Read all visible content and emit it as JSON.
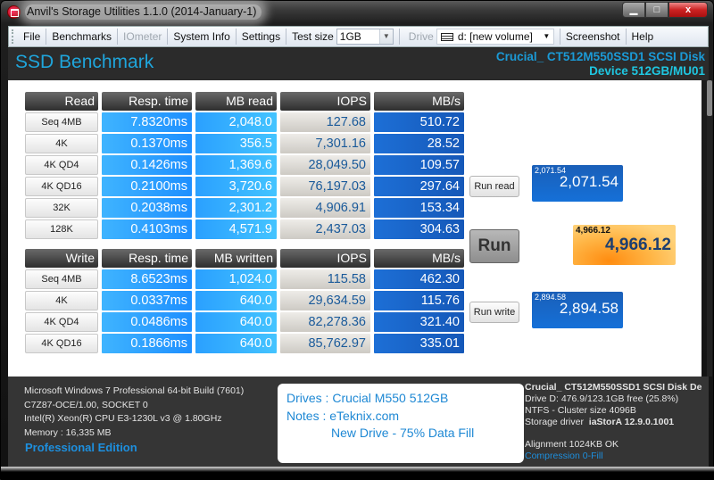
{
  "window": {
    "title": "Anvil's Storage Utilities 1.1.0 (2014-January-1)",
    "controls": {
      "minimize": "▁",
      "maximize": "□",
      "close": "x"
    }
  },
  "menu": {
    "file": "File",
    "benchmarks": "Benchmarks",
    "iometer": "IOmeter",
    "system_info": "System Info",
    "settings": "Settings",
    "test_size_label": "Test size",
    "test_size_value": "1GB",
    "drive_label": "Drive",
    "drive_value": "d: [new volume]",
    "screenshot": "Screenshot",
    "help": "Help"
  },
  "header": {
    "title": "SSD Benchmark",
    "device_line1": "Crucial_ CT512M550SSD1 SCSI Disk",
    "device_line2": "Device 512GB/MU01"
  },
  "read": {
    "headers": [
      "Read",
      "Resp. time",
      "MB read",
      "IOPS",
      "MB/s"
    ],
    "rows": [
      {
        "label": "Seq 4MB",
        "resp": "7.8320ms",
        "mb": "2,048.0",
        "iops": "127.68",
        "mbs": "510.72"
      },
      {
        "label": "4K",
        "resp": "0.1370ms",
        "mb": "356.5",
        "iops": "7,301.16",
        "mbs": "28.52"
      },
      {
        "label": "4K QD4",
        "resp": "0.1426ms",
        "mb": "1,369.6",
        "iops": "28,049.50",
        "mbs": "109.57"
      },
      {
        "label": "4K QD16",
        "resp": "0.2100ms",
        "mb": "3,720.6",
        "iops": "76,197.03",
        "mbs": "297.64"
      },
      {
        "label": "32K",
        "resp": "0.2038ms",
        "mb": "2,301.2",
        "iops": "4,906.91",
        "mbs": "153.34"
      },
      {
        "label": "128K",
        "resp": "0.4103ms",
        "mb": "4,571.9",
        "iops": "2,437.03",
        "mbs": "304.63"
      }
    ]
  },
  "write": {
    "headers": [
      "Write",
      "Resp. time",
      "MB written",
      "IOPS",
      "MB/s"
    ],
    "rows": [
      {
        "label": "Seq 4MB",
        "resp": "8.6523ms",
        "mb": "1,024.0",
        "iops": "115.58",
        "mbs": "462.30"
      },
      {
        "label": "4K",
        "resp": "0.0337ms",
        "mb": "640.0",
        "iops": "29,634.59",
        "mbs": "115.76"
      },
      {
        "label": "4K QD4",
        "resp": "0.0486ms",
        "mb": "640.0",
        "iops": "82,278.36",
        "mbs": "321.40"
      },
      {
        "label": "4K QD16",
        "resp": "0.1866ms",
        "mb": "640.0",
        "iops": "85,762.97",
        "mbs": "335.01"
      }
    ]
  },
  "buttons": {
    "run_read": "Run read",
    "run": "Run",
    "run_write": "Run write"
  },
  "scores": {
    "read_small": "2,071.54",
    "read": "2,071.54",
    "total_small": "4,966.12",
    "total": "4,966.12",
    "write_small": "2,894.58",
    "write": "2,894.58"
  },
  "footer": {
    "system": [
      "Microsoft Windows 7 Professional  64-bit Build (7601)",
      "C7Z87-OCE/1.00, SOCKET 0",
      "Intel(R) Xeon(R) CPU E3-1230L v3 @ 1.80GHz",
      "Memory : 16,335 MB"
    ],
    "edition": "Professional Edition",
    "notes": {
      "drives": "Drives : Crucial M550 512GB",
      "notes": "Notes : eTeknix.com",
      "extra": "New Drive - 75% Data Fill"
    },
    "drive": {
      "model": "Crucial_ CT512M550SSD1 SCSI Disk De",
      "free": "Drive D: 476.9/123.1GB free (25.8%)",
      "fs": "NTFS - Cluster size 4096B",
      "driver_label": "Storage driver",
      "driver_value": "iaStorA 12.9.0.1001",
      "alignment": "Alignment 1024KB OK",
      "compression": "Compression 0-Fill"
    }
  }
}
